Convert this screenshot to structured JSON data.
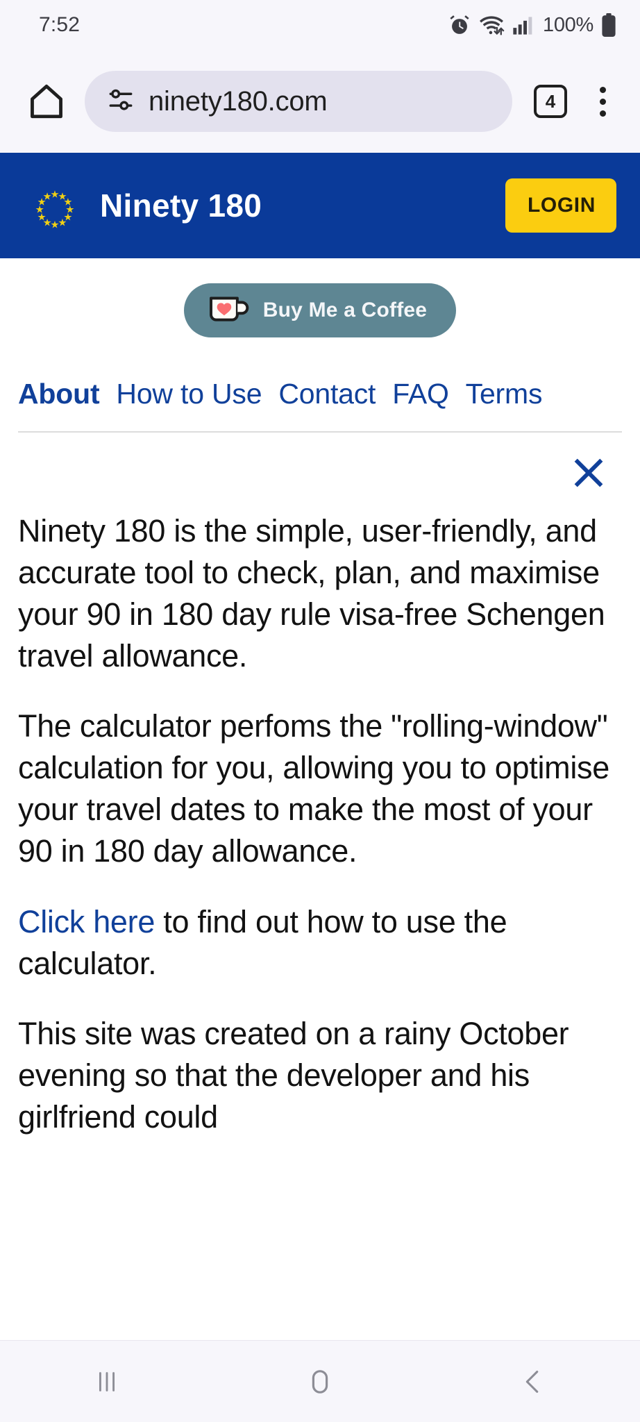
{
  "status_bar": {
    "time": "7:52",
    "battery_percent": "100%",
    "icons": [
      "alarm-icon",
      "wifi-icon",
      "cellular-signal-icon",
      "battery-icon"
    ]
  },
  "browser": {
    "home_icon": "home-icon",
    "site_settings_icon": "tune-icon",
    "url": "ninety180.com",
    "tab_count": "4",
    "menu_icon": "overflow-menu-icon"
  },
  "site_header": {
    "logo": "eu-flag-icon",
    "title": "Ninety 180",
    "login_label": "LOGIN",
    "bg_color": "#0a3a99",
    "login_color": "#fbcd10"
  },
  "support": {
    "label": "Buy Me a Coffee",
    "icon": "coffee-cup-heart-icon",
    "bg_color": "#5e8693"
  },
  "nav": {
    "items": [
      {
        "label": "About",
        "active": true
      },
      {
        "label": "How to Use",
        "active": false
      },
      {
        "label": "Contact",
        "active": false
      },
      {
        "label": "FAQ",
        "active": false
      },
      {
        "label": "Terms",
        "active": false
      }
    ],
    "link_color": "#10409a"
  },
  "panel": {
    "close_icon": "close-icon"
  },
  "content": {
    "paragraph_1": "Ninety 180 is the simple, user-friendly, and accurate tool to check, plan, and maximise your 90 in 180 day rule visa-free Schengen travel allowance.",
    "paragraph_2": "The calculator perfoms the \"rolling-window\" calculation for you, allowing you to optimise your travel dates to make the most of your 90 in 180 day allowance.",
    "paragraph_3_link": "Click here",
    "paragraph_3_rest": " to find out how to use the calculator.",
    "paragraph_4": "This site was created on a rainy October evening so that the developer and his girlfriend could"
  },
  "system_nav": {
    "recents": "recents-icon",
    "home": "home-button-icon",
    "back": "back-icon"
  }
}
